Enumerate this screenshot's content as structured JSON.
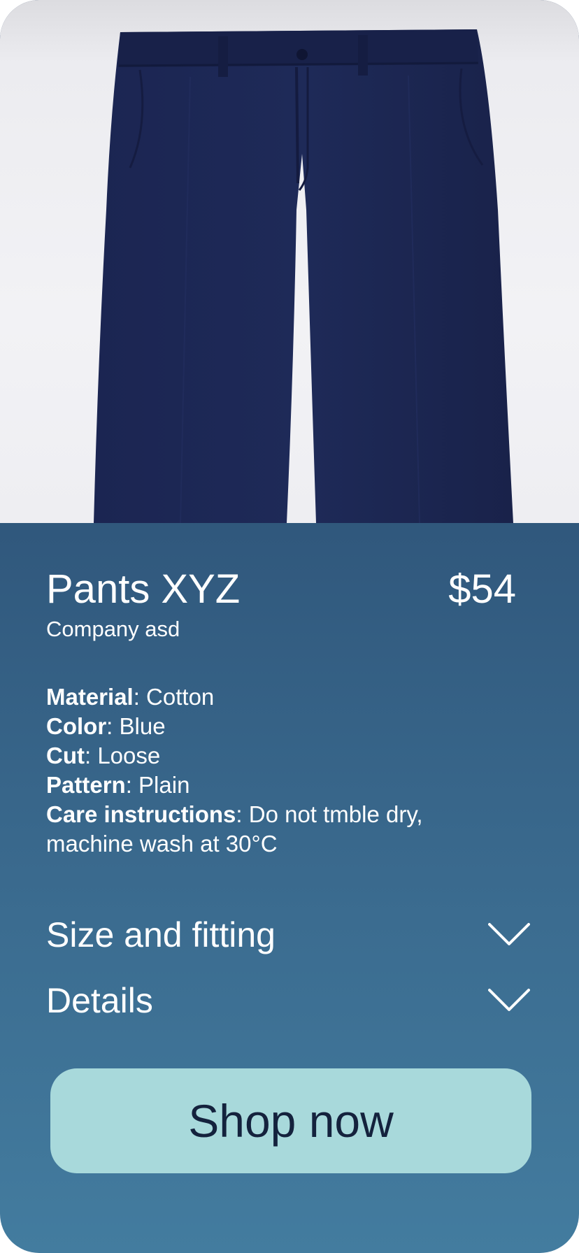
{
  "product": {
    "name": "Pants XYZ",
    "price": "$54",
    "company": "Company asd",
    "image_icon": "pants-photo"
  },
  "specs": [
    {
      "key": "Material",
      "value": ": Cotton"
    },
    {
      "key": "Color",
      "value": ": Blue"
    },
    {
      "key": "Cut",
      "value": ": Loose"
    },
    {
      "key": "Pattern",
      "value": ": Plain"
    },
    {
      "key": "Care instructions",
      "value": ": Do not tmble dry, machine wash at 30°C"
    }
  ],
  "accordions": {
    "size_label": "Size and fitting",
    "details_label": "Details",
    "icon": "chevron-down-icon"
  },
  "cta": {
    "label": "Shop now"
  },
  "colors": {
    "card_top": "#223b63",
    "card_bottom": "#437c9f",
    "button_bg": "#a8d9db",
    "button_text": "#14223d",
    "pants": "#1c2650"
  }
}
